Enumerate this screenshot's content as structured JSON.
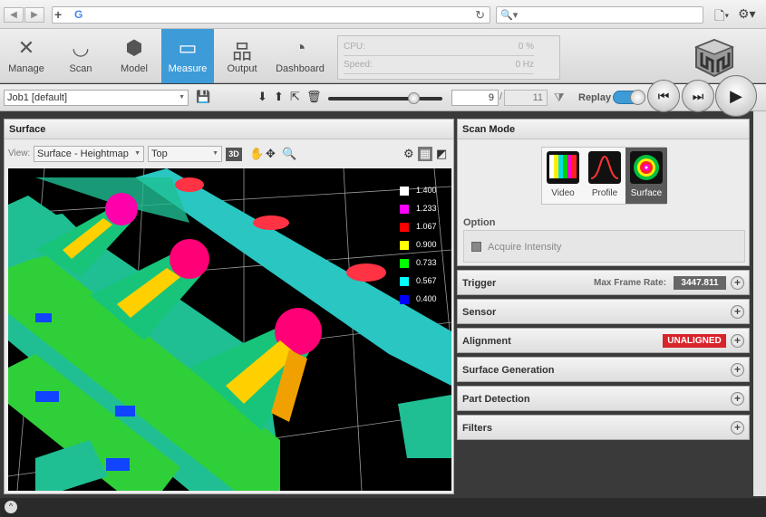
{
  "browser": {
    "back_icon": "back-icon",
    "forward_icon": "forward-icon",
    "url": "",
    "search_placeholder": "",
    "glyphs": {
      "back": "◀",
      "forward": "▶",
      "plus": "+",
      "g": "G",
      "reload": "↻",
      "search": "🔍▾",
      "page": "🗋▾",
      "gear": "⚙▾"
    }
  },
  "toolbar": {
    "tools": [
      {
        "label": "Manage",
        "icon": "tools-icon",
        "glyph": "✕"
      },
      {
        "label": "Scan",
        "icon": "scan-icon",
        "glyph": "◡"
      },
      {
        "label": "Model",
        "icon": "cubes-icon",
        "glyph": "⬢"
      },
      {
        "label": "Measure",
        "icon": "ruler-icon",
        "glyph": "▭"
      },
      {
        "label": "Output",
        "icon": "network-icon",
        "glyph": "品"
      },
      {
        "label": "Dashboard",
        "icon": "gauge-icon",
        "glyph": "◔"
      }
    ],
    "active_tool": "Measure",
    "status": {
      "cpu_label": "CPU:",
      "cpu_value": "0 %",
      "speed_label": "Speed:",
      "speed_value": "0 Hz"
    }
  },
  "jobbar": {
    "job": "Job1 [default]",
    "frame": "9",
    "frame_sep": "/",
    "frame_total": "11",
    "replay_label": "Replay",
    "replay_on": true,
    "slider_fraction": 0.78,
    "glyphs": {
      "arrow": "▼",
      "save": "💾",
      "download": "⬇",
      "upload": "⬆",
      "export": "⇱",
      "trash": "🗑",
      "filter": "⧩",
      "first": "⏮",
      "next": "⏭",
      "play": "▶"
    }
  },
  "surface": {
    "title": "Surface",
    "view_label": "View:",
    "view_mode": "Surface - Heightmap",
    "view_orient": "Top",
    "badge": "3D",
    "legend": [
      {
        "value": "1.400",
        "color": "#ffffff"
      },
      {
        "value": "1.233",
        "color": "#ff00ff"
      },
      {
        "value": "1.067",
        "color": "#ff0000"
      },
      {
        "value": "0.900",
        "color": "#ffff00"
      },
      {
        "value": "0.733",
        "color": "#00ff00"
      },
      {
        "value": "0.567",
        "color": "#00ffff"
      },
      {
        "value": "0.400",
        "color": "#0000ff"
      }
    ],
    "glyphs": {
      "arrow": "▼",
      "hand": "✋",
      "rotate": "✥",
      "zoom": "🔍",
      "settings": "⚙",
      "grid": "▦",
      "window": "◩"
    }
  },
  "scan_mode": {
    "title": "Scan Mode",
    "modes": [
      "Video",
      "Profile",
      "Surface"
    ],
    "active_mode": "Surface",
    "option_label": "Option",
    "acquire_label": "Acquire Intensity",
    "acquire_checked": false
  },
  "sections": {
    "trigger": "Trigger",
    "max_frame_label": "Max Frame Rate:",
    "max_frame_value": "3447.811",
    "sensor": "Sensor",
    "alignment": "Alignment",
    "alignment_status": "UNALIGNED",
    "surface_generation": "Surface Generation",
    "part_detection": "Part Detection",
    "filters": "Filters",
    "plus": "+"
  },
  "bottom": {
    "chevron": "^"
  },
  "colors": {
    "accent": "#3d9bd8",
    "alert": "#d9232a"
  }
}
